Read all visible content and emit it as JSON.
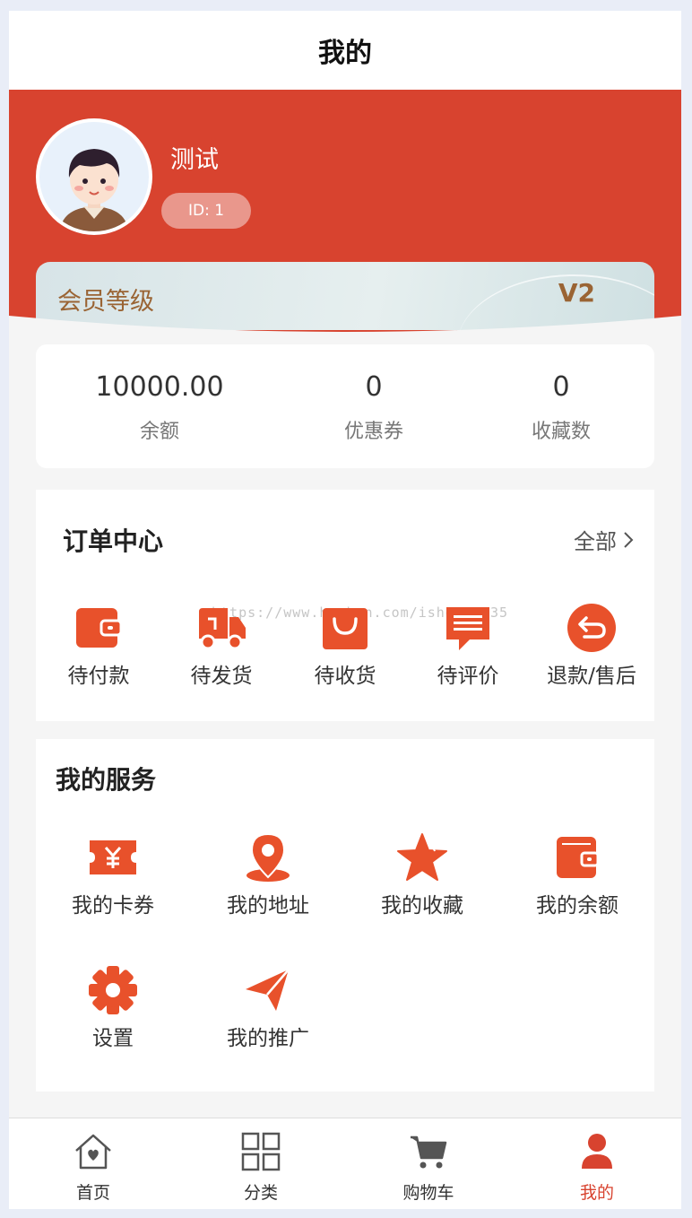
{
  "navbar": {
    "title": "我的"
  },
  "profile": {
    "username": "测试",
    "id_label": "ID: 1"
  },
  "member": {
    "label": "会员等级",
    "level": "V2"
  },
  "stats": [
    {
      "value": "10000.00",
      "label": "余额"
    },
    {
      "value": "0",
      "label": "优惠券"
    },
    {
      "value": "0",
      "label": "收藏数"
    }
  ],
  "orders": {
    "title": "订单中心",
    "all_label": "全部",
    "watermark": "https://www.huzhan.com/ishop11135",
    "items": [
      {
        "label": "待付款",
        "icon": "wallet-icon"
      },
      {
        "label": "待发货",
        "icon": "truck-icon"
      },
      {
        "label": "待收货",
        "icon": "shopping-bag-icon"
      },
      {
        "label": "待评价",
        "icon": "comment-icon"
      },
      {
        "label": "退款/售后",
        "icon": "return-icon"
      }
    ]
  },
  "services": {
    "title": "我的服务",
    "items": [
      {
        "label": "我的卡券",
        "icon": "coupon-icon"
      },
      {
        "label": "我的地址",
        "icon": "location-icon"
      },
      {
        "label": "我的收藏",
        "icon": "star-icon"
      },
      {
        "label": "我的余额",
        "icon": "wallet-icon"
      },
      {
        "label": "设置",
        "icon": "gear-icon"
      },
      {
        "label": "我的推广",
        "icon": "paper-plane-icon"
      }
    ]
  },
  "tabbar": {
    "items": [
      {
        "label": "首页",
        "icon": "home-icon"
      },
      {
        "label": "分类",
        "icon": "grid-icon"
      },
      {
        "label": "购物车",
        "icon": "cart-icon"
      },
      {
        "label": "我的",
        "icon": "user-icon",
        "active": true
      }
    ]
  },
  "colors": {
    "accent": "#d8432f",
    "icon": "#e8512b",
    "member_text": "#9a6434"
  }
}
